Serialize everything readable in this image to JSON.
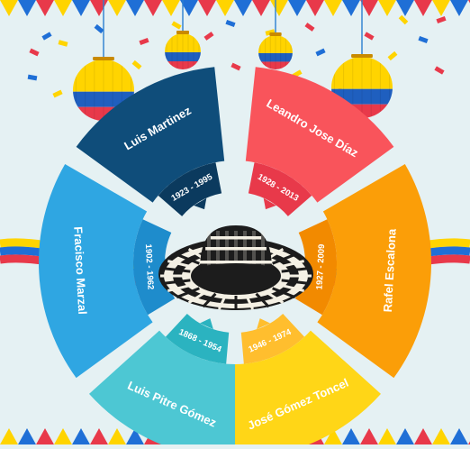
{
  "segments": [
    {
      "name": "Luis Pitre Gómez",
      "years": "1868 - 1954",
      "color": "#4dc7d3",
      "tab": "#2bb3c0"
    },
    {
      "name": "Fracisco Marzal",
      "years": "1902 - 1962",
      "color": "#2fa6e2",
      "tab": "#1e8ccc"
    },
    {
      "name": "Luis Martinez",
      "years": "1923 - 1995",
      "color": "#0f4d7a",
      "tab": "#0b3a5e"
    },
    {
      "name": "Leandro Jose Díaz",
      "years": "1928 - 2013",
      "color": "#f9545b",
      "tab": "#e8394a"
    },
    {
      "name": "Rafel Escalona",
      "years": "1927 - 2009",
      "color": "#fb9e08",
      "tab": "#f28a00"
    },
    {
      "name": "José Gómez Toncel",
      "years": "1946 - 1974",
      "color": "#ffd617",
      "tab": "#ffbe2e"
    }
  ],
  "colors": {
    "background": "#e5f1f3",
    "yellow": "#ffd400",
    "blue": "#1f6fd6",
    "red": "#e8394a"
  },
  "icons": {
    "center": "sombrero-vueltiao-icon",
    "decoration": "paper-lantern-icon"
  }
}
